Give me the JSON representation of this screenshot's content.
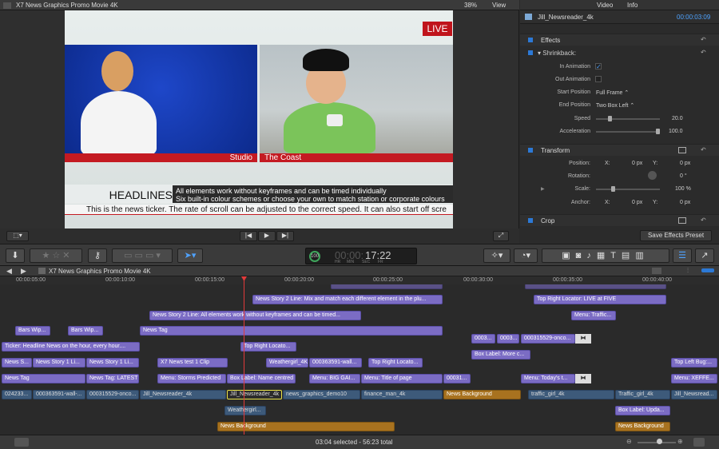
{
  "viewer": {
    "project_title": "X7 News Graphics Promo Movie 4K",
    "zoom": "38%",
    "view_menu": "View",
    "live_badge": "LIVE",
    "caption_left": "Studio",
    "caption_right": "The Coast",
    "headline_label": "HEADLINES",
    "headline_line1": "All elements work without keyframes and can be timed  individually",
    "headline_line2": "Six built-in colour schemes or choose your own to match station or corporate colours",
    "ticker": "This is the news ticker. The rate of scroll can be adjusted to the correct speed. It can also start off scre"
  },
  "inspector": {
    "tabs": [
      "Video",
      "Info"
    ],
    "clip_name": "Jill_Newsreader_4k",
    "clip_time": "00:00:03:09",
    "effects_label": "Effects",
    "shrinkback_label": "Shrinkback:",
    "rows": [
      {
        "label": "In Animation",
        "value": "✓"
      },
      {
        "label": "Out Animation",
        "value": ""
      },
      {
        "label": "Start Position",
        "value": "Full Frame ⌃"
      },
      {
        "label": "End Position",
        "value": "Two Box Left ⌃"
      },
      {
        "label": "Speed",
        "value": "20.0"
      },
      {
        "label": "Acceleration",
        "value": "100.0"
      }
    ],
    "speed_level": 0.2,
    "acceleration_level": 1.0,
    "transform_label": "Transform",
    "position": {
      "label": "Position:",
      "x_label": "X:",
      "x": "0 px",
      "y_label": "Y:",
      "y": "0 px"
    },
    "rotation": {
      "label": "Rotation:",
      "value": "0 °"
    },
    "scale": {
      "label": "Scale:",
      "value": "100 %",
      "level": 0.25
    },
    "anchor": {
      "label": "Anchor:",
      "x_label": "X:",
      "x": "0 px",
      "y_label": "Y:",
      "y": "0 px"
    },
    "crop_label": "Crop",
    "save_button": "Save Effects Preset"
  },
  "toolbar": {
    "timecode": "17:22",
    "timecode_prefix": "00:00:",
    "timecode_units": [
      "HR",
      "MIN",
      "SEC",
      "FR"
    ],
    "badge": "100"
  },
  "timeline": {
    "title": "X7 News Graphics Promo Movie 4K",
    "ruler": [
      "00:00:05:00",
      "00:00:10:00",
      "00:00:15:00",
      "00:00:20:00",
      "00:00:25:00",
      "00:00:30:00",
      "00:00:35:00",
      "00:00:40:00"
    ],
    "clips": [
      {
        "label": "News Story 2 Line: Mix and match each different element in the plu...",
        "row": "r2",
        "kind": "title"
      },
      {
        "label": "Top Right Locator: LIVE at FIVE",
        "row": "r2b",
        "kind": "title"
      },
      {
        "label": "News Story 2 Line: All elements work without keyframes and can be timed...",
        "row": "r3",
        "kind": "title"
      },
      {
        "label": "Menu: Traffic...",
        "row": "r3b",
        "kind": "title"
      },
      {
        "label": "Bars Wip...",
        "row": "r4a",
        "kind": "title"
      },
      {
        "label": "Bars Wip...",
        "row": "r4b",
        "kind": "title"
      },
      {
        "label": "News Tag",
        "row": "r4c",
        "kind": "title"
      },
      {
        "label": "0003...",
        "row": "r5a",
        "kind": "title"
      },
      {
        "label": "0003...",
        "row": "r5b",
        "kind": "title"
      },
      {
        "label": "000315529-onco...",
        "row": "r5c",
        "kind": "title"
      },
      {
        "label": "Ticker: Headline News on the hour, every hour....",
        "row": "r6a",
        "kind": "title"
      },
      {
        "label": "Top Right Locato...",
        "row": "r6b",
        "kind": "title"
      },
      {
        "label": "Box Label: More c...",
        "row": "r6c",
        "kind": "title"
      },
      {
        "label": "News S...",
        "row": "r7a",
        "kind": "title"
      },
      {
        "label": "News Story 1 Li...",
        "row": "r7b",
        "kind": "title"
      },
      {
        "label": "News Story 1 Li...",
        "row": "r7c",
        "kind": "title"
      },
      {
        "label": "X7 News test 1 Clip",
        "row": "r7d",
        "kind": "title"
      },
      {
        "label": "Weathergirl_4K",
        "row": "r7e",
        "kind": "title"
      },
      {
        "label": "000363591-wall...",
        "row": "r7f",
        "kind": "title"
      },
      {
        "label": "Top Right Locato...",
        "row": "r7g",
        "kind": "title"
      },
      {
        "label": "Top Left Bug:...",
        "row": "r7h",
        "kind": "title"
      },
      {
        "label": "News Tag",
        "row": "r8a",
        "kind": "title"
      },
      {
        "label": "News Tag: LATEST",
        "row": "r8b",
        "kind": "title"
      },
      {
        "label": "Menu: Storms Predicted",
        "row": "r8c",
        "kind": "title"
      },
      {
        "label": "Box Label: Name centred",
        "row": "r8d",
        "kind": "title"
      },
      {
        "label": "Menu: BIG GAI...",
        "row": "r8e",
        "kind": "title"
      },
      {
        "label": "Menu: Title of page",
        "row": "r8f",
        "kind": "title"
      },
      {
        "label": "00031...",
        "row": "r8g",
        "kind": "title"
      },
      {
        "label": "Menu: Today's t...",
        "row": "r8h",
        "kind": "title"
      },
      {
        "label": "Menu: XEFFE...",
        "row": "r8i",
        "kind": "title"
      },
      {
        "label": "024233...",
        "row": "p1",
        "kind": "video"
      },
      {
        "label": "000363591-wall-...",
        "row": "p2",
        "kind": "video"
      },
      {
        "label": "000315529-onco...",
        "row": "p3",
        "kind": "video"
      },
      {
        "label": "Jill_Newsreader_4k",
        "row": "p4",
        "kind": "video"
      },
      {
        "label": "Jill_Newsreader_4k",
        "row": "p5",
        "kind": "video"
      },
      {
        "label": "news_graphics_demo10",
        "row": "p6",
        "kind": "video"
      },
      {
        "label": "finance_man_4k",
        "row": "p7",
        "kind": "video"
      },
      {
        "label": "News Background",
        "row": "p8",
        "kind": "audio"
      },
      {
        "label": "traffic_girl_4k",
        "row": "p9",
        "kind": "video"
      },
      {
        "label": "Traffic_girl_4k",
        "row": "p10",
        "kind": "video"
      },
      {
        "label": "Jill_Newsread...",
        "row": "p11",
        "kind": "video"
      },
      {
        "label": "Weathergirl...",
        "row": "b1",
        "kind": "video"
      },
      {
        "label": "Box Label: Upda...",
        "row": "b2",
        "kind": "title"
      },
      {
        "label": "News Background",
        "row": "b3",
        "kind": "audio"
      },
      {
        "label": "News Background",
        "row": "b4",
        "kind": "audio"
      }
    ]
  },
  "status": {
    "text": "03:04 selected - 56:23 total"
  }
}
